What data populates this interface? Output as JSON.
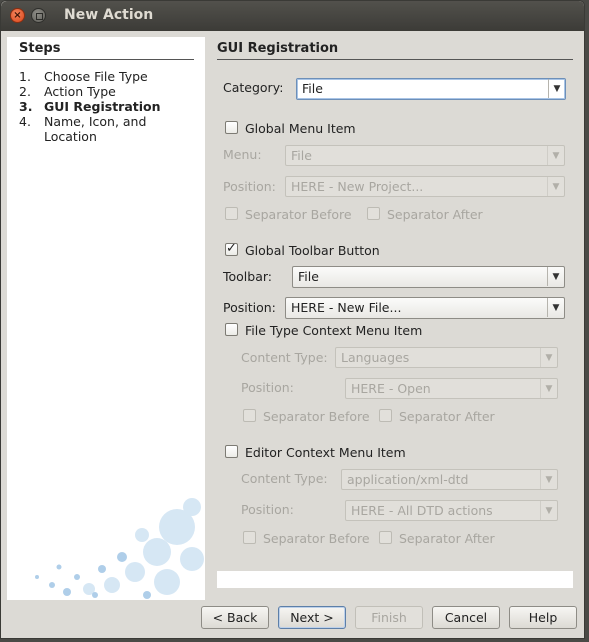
{
  "window": {
    "title": "New Action"
  },
  "steps": {
    "heading": "Steps",
    "items": [
      {
        "num": "1.",
        "label": "Choose File Type",
        "current": false
      },
      {
        "num": "2.",
        "label": "Action Type",
        "current": false
      },
      {
        "num": "3.",
        "label": "GUI Registration",
        "current": true
      },
      {
        "num": "4.",
        "label": "Name, Icon, and Location",
        "current": false
      }
    ]
  },
  "gui": {
    "heading": "GUI Registration",
    "category": {
      "label": "Category:",
      "value": "File"
    },
    "global_menu": {
      "label": "Global Menu Item",
      "checked": false,
      "menu_label": "Menu:",
      "menu_value": "File",
      "position_label": "Position:",
      "position_value": "HERE - New Project...",
      "sep_before": "Separator Before",
      "sep_after": "Separator After"
    },
    "global_toolbar": {
      "label": "Global Toolbar Button",
      "checked": true,
      "toolbar_label": "Toolbar:",
      "toolbar_value": "File",
      "position_label": "Position:",
      "position_value": "HERE - New File..."
    },
    "file_type_context": {
      "label": "File Type Context Menu Item",
      "checked": false,
      "content_type_label": "Content Type:",
      "content_type_value": "Languages",
      "position_label": "Position:",
      "position_value": "HERE - Open",
      "sep_before": "Separator Before",
      "sep_after": "Separator After"
    },
    "editor_context": {
      "label": "Editor Context Menu Item",
      "checked": false,
      "content_type_label": "Content Type:",
      "content_type_value": "application/xml-dtd",
      "position_label": "Position:",
      "position_value": "HERE - All DTD actions",
      "sep_before": "Separator Before",
      "sep_after": "Separator After"
    }
  },
  "buttons": {
    "back": "< Back",
    "next": "Next >",
    "finish": "Finish",
    "cancel": "Cancel",
    "help": "Help"
  },
  "icons": {
    "close": "close-icon",
    "minimize": "minimize-icon",
    "dropdown": "chevron-down-icon",
    "check": "checkmark-icon"
  }
}
